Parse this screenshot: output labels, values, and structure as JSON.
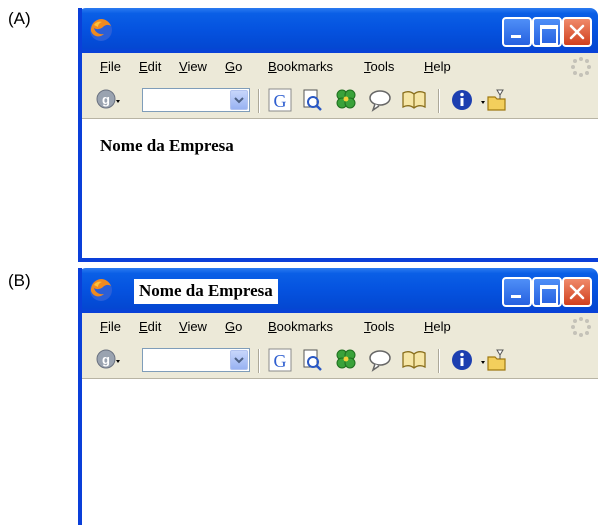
{
  "panels": [
    {
      "label": "(A)",
      "window_title": "",
      "page_heading": "Nome da Empresa"
    },
    {
      "label": "(B)",
      "window_title": "Nome da Empresa",
      "page_heading": ""
    }
  ],
  "menu": {
    "file": "File",
    "edit": "Edit",
    "view": "View",
    "go": "Go",
    "bookmarks": "Bookmarks",
    "tools": "Tools",
    "help": "Help"
  },
  "toolbar_icons": [
    "google-toolbar-icon",
    "search-combo",
    "google-search-icon",
    "page-info-icon",
    "clover-icon",
    "speech-bubble-icon",
    "book-icon",
    "info-icon",
    "folder-icon"
  ],
  "colors": {
    "titlebar": "#0552df",
    "frame": "#0a3fd9",
    "chrome": "#ece9d8",
    "close_button": "#d0401e"
  }
}
